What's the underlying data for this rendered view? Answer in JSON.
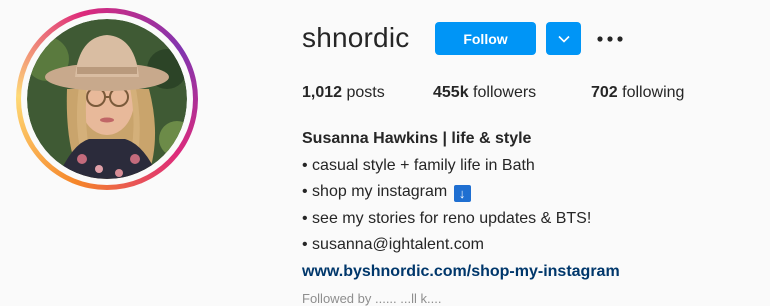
{
  "profile": {
    "username": "shnordic",
    "follow_label": "Follow",
    "stats": {
      "posts_count": "1,012",
      "posts_label": "posts",
      "followers_count": "455k",
      "followers_label": "followers",
      "following_count": "702",
      "following_label": "following"
    },
    "bio": {
      "name": "Susanna Hawkins | life & style",
      "line1": "• casual style + family life in Bath",
      "line2": "• shop my instagram",
      "line2_emoji": "↓",
      "line3": "• see my stories for reno updates & BTS!",
      "line4": "• susanna@ightalent.com",
      "link": "www.byshnordic.com/shop-my-instagram"
    },
    "followed_by": "Followed by ...... ...ll k...."
  },
  "colors": {
    "accent": "#0095f6",
    "link": "#00376b",
    "text": "#262626"
  },
  "icons": {
    "dropdown": "chevron-down-icon",
    "more": "more-options-icon"
  }
}
